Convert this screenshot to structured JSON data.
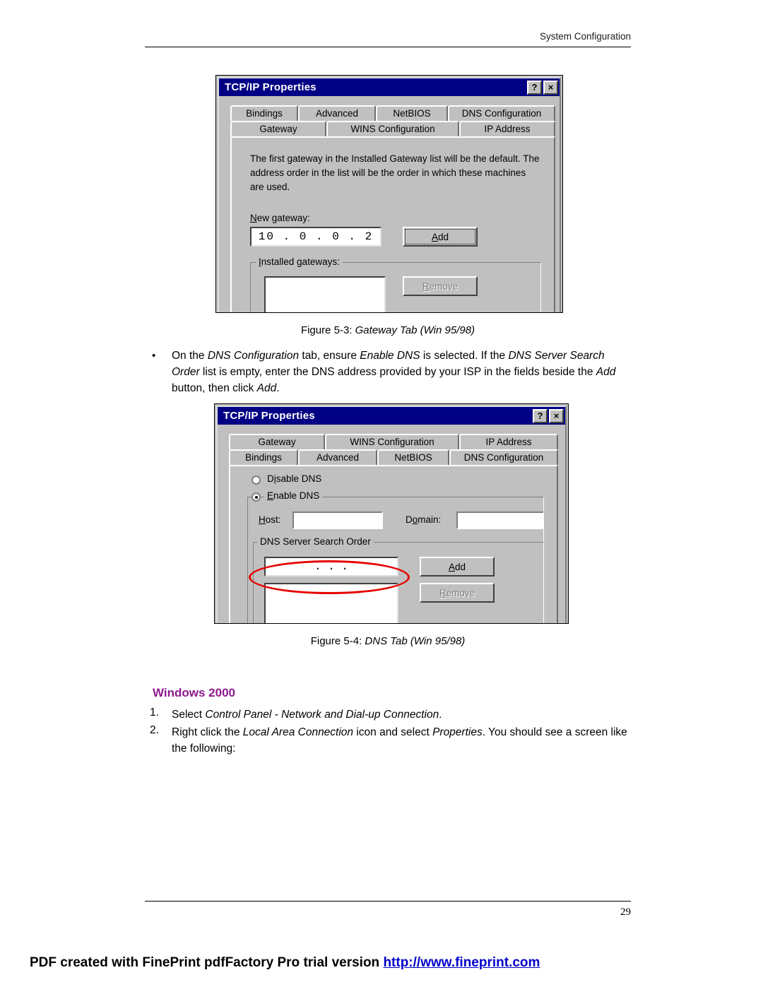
{
  "page": {
    "header_title": "System Configuration",
    "page_number": "29"
  },
  "figure1": {
    "caption_prefix": "Figure 5-3: ",
    "caption_italic": "Gateway Tab (Win 95/98)",
    "dialog": {
      "title": "TCP/IP Properties",
      "help_button": "?",
      "close_button": "×",
      "tabs_row1": [
        "Bindings",
        "Advanced",
        "NetBIOS",
        "DNS Configuration"
      ],
      "tabs_row2": [
        "Gateway",
        "WINS Configuration",
        "IP Address"
      ],
      "active_tab": "Gateway",
      "description": "The first gateway in the Installed Gateway list will be the default. The address order in the list will be the order in which these machines are used.",
      "new_gateway_label": "New gateway:",
      "new_gateway_value": "10 .  0  .  0  .  2",
      "add_button": "Add",
      "installed_gateways_label": "Installed gateways:",
      "remove_button": "Remove"
    }
  },
  "bullet1": {
    "marker": "•",
    "segments": [
      {
        "text": "On the ",
        "italic": false
      },
      {
        "text": "DNS Configuration",
        "italic": true
      },
      {
        "text": " tab, ensure ",
        "italic": false
      },
      {
        "text": "Enable DNS",
        "italic": true
      },
      {
        "text": " is selected. If the ",
        "italic": false
      },
      {
        "text": "DNS Server Search Order",
        "italic": true
      },
      {
        "text": " list is empty, enter the DNS address provided by your ISP in the fields beside the ",
        "italic": false
      },
      {
        "text": "Add",
        "italic": true
      },
      {
        "text": " button, then click ",
        "italic": false
      },
      {
        "text": "Add",
        "italic": true
      },
      {
        "text": ".",
        "italic": false
      }
    ]
  },
  "figure2": {
    "caption_prefix": "Figure 5-4: ",
    "caption_italic": "DNS Tab (Win 95/98)",
    "dialog": {
      "title": "TCP/IP Properties",
      "help_button": "?",
      "close_button": "×",
      "tabs_row1": [
        "Gateway",
        "WINS Configuration",
        "IP Address"
      ],
      "tabs_row2": [
        "Bindings",
        "Advanced",
        "NetBIOS",
        "DNS Configuration"
      ],
      "active_tab": "DNS Configuration",
      "radio_disable": "Disable DNS",
      "radio_enable": "Enable DNS",
      "radio_selected": "Enable DNS",
      "host_label": "Host:",
      "host_value": "",
      "domain_label": "Domain:",
      "domain_value": "",
      "search_order_label": "DNS Server Search Order",
      "search_order_value": ".           .           .",
      "add_button": "Add",
      "remove_button": "Remove"
    },
    "annotation": "red-ellipse-highlight"
  },
  "windows2000": {
    "heading": "Windows 2000",
    "steps": [
      {
        "marker": "1.",
        "segments": [
          {
            "text": "Select ",
            "italic": false
          },
          {
            "text": "Control Panel - Network and Dial-up Connection",
            "italic": true
          },
          {
            "text": ".",
            "italic": false
          }
        ]
      },
      {
        "marker": "2.",
        "segments": [
          {
            "text": "Right click the ",
            "italic": false
          },
          {
            "text": "Local Area Connection",
            "italic": true
          },
          {
            "text": " icon and select ",
            "italic": false
          },
          {
            "text": "Properties",
            "italic": true
          },
          {
            "text": ". You should see a screen like the following:",
            "italic": false
          }
        ]
      }
    ]
  },
  "footer": {
    "text_before_url": "PDF created with FinePrint pdfFactory Pro trial version ",
    "url": "http://www.fineprint.com"
  }
}
